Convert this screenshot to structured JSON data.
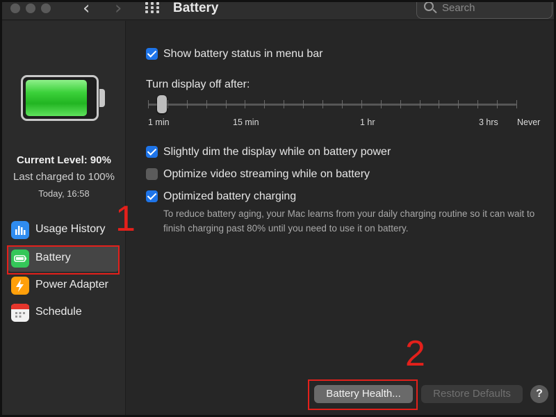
{
  "window": {
    "title": "Battery",
    "search_placeholder": "Search"
  },
  "sidebar": {
    "level_text": "Current Level: 90%",
    "level_percent": 90,
    "last_charged": "Last charged to 100%",
    "charged_time": "Today, 16:58",
    "items": [
      {
        "label": "Usage History",
        "icon": "usage-history-icon",
        "color": "#2f8cf0",
        "selected": false
      },
      {
        "label": "Battery",
        "icon": "battery-icon",
        "color": "#34c759",
        "selected": true
      },
      {
        "label": "Power Adapter",
        "icon": "power-adapter-icon",
        "color": "#ff9f0a",
        "selected": false
      },
      {
        "label": "Schedule",
        "icon": "calendar-icon",
        "color": "#f2f2f2",
        "selected": false
      }
    ]
  },
  "main": {
    "show_status": {
      "label": "Show battery status in menu bar",
      "checked": true
    },
    "display_off_label": "Turn display off after:",
    "slider": {
      "labels": [
        "1 min",
        "15 min",
        "1 hr",
        "3 hrs",
        "Never"
      ],
      "value": "1 min"
    },
    "dim_display": {
      "label": "Slightly dim the display while on battery power",
      "checked": true
    },
    "optimize_video": {
      "label": "Optimize video streaming while on battery",
      "checked": false
    },
    "optimized_charging": {
      "label": "Optimized battery charging",
      "checked": true,
      "description": "To reduce battery aging, your Mac learns from your daily charging routine so it can wait to finish charging past 80% until you need to use it on battery."
    },
    "buttons": {
      "battery_health": "Battery Health...",
      "restore_defaults": "Restore Defaults",
      "help": "?"
    }
  },
  "annotations": {
    "step1": "1",
    "step2": "2",
    "color": "#e3201b"
  },
  "colors": {
    "accent": "#1e74e8",
    "background": "#262626"
  }
}
